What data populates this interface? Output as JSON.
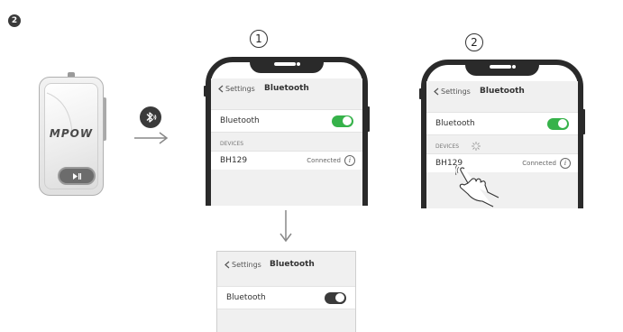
{
  "step_badge": "2",
  "device": {
    "brand": "MPOW",
    "button_icon": "play-pause-icon"
  },
  "bluetooth_icon": "bluetooth-icon",
  "phone1": {
    "number": "1",
    "back_label": "Settings",
    "title": "Bluetooth",
    "bluetooth_label": "Bluetooth",
    "toggle_state": "on",
    "section_header": "DEVICES",
    "device_name": "BH129",
    "device_status": "Connected",
    "info_icon": "i"
  },
  "phone2": {
    "number": "2",
    "back_label": "Settings",
    "title": "Bluetooth",
    "bluetooth_label": "Bluetooth",
    "toggle_state": "on",
    "section_header": "DEVICES",
    "device_name": "BH129",
    "device_status": "Connected",
    "info_icon": "i"
  },
  "panel": {
    "back_label": "Settings",
    "title": "Bluetooth",
    "bluetooth_label": "Bluetooth",
    "toggle_state": "off"
  },
  "colors": {
    "toggle_on": "#36b24a",
    "toggle_off": "#3a3a3a",
    "phone_frame": "#2a2a2a"
  }
}
